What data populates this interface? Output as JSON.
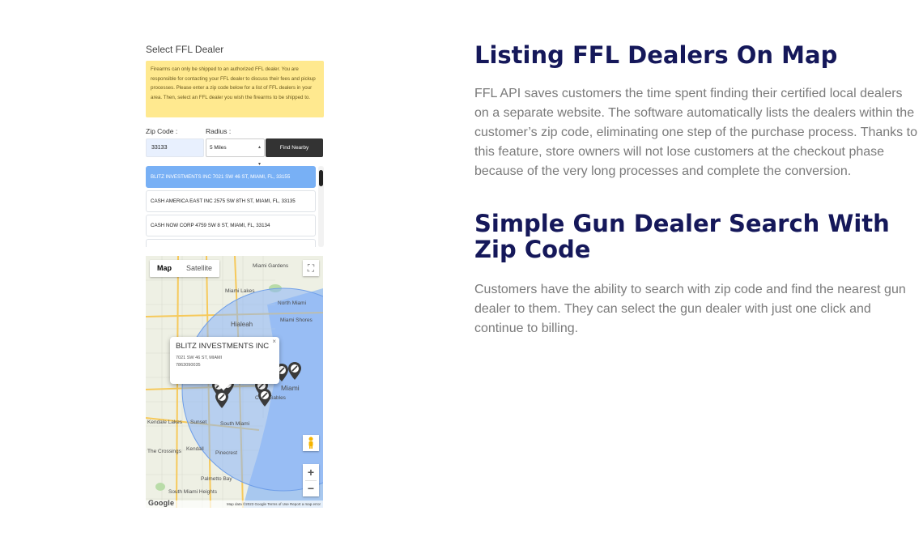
{
  "widget": {
    "title": "Select FFL Dealer",
    "notice": "Firearms can only be shipped to an authorized FFL dealer. You are responsible for contacting your FFL dealer to discuss their fees and pickup processes. Please enter a zip code below for a list of FFL dealers in your area. Then, select an FFL dealer you wish the firearms to be shipped to.",
    "zip_label": "Zip Code :",
    "radius_label": "Radius :",
    "zip_value": "33133",
    "radius_value": "5 Miles",
    "find_button": "Find Nearby",
    "dealers": [
      "BLITZ INVESTMENTS INC 7021 SW 46 ST, MIAMI, FL, 33155",
      "CASH AMERICA EAST INC 2575 SW 8TH ST, MIAMI, FL, 33135",
      "CASH NOW CORP 4759 SW 8 ST, MIAMI, FL, 33134"
    ]
  },
  "map": {
    "type_map": "Map",
    "type_satellite": "Satellite",
    "fullscreen_icon": "fullscreen-icon",
    "pegman_icon": "pegman-icon",
    "zoom_in": "+",
    "zoom_out": "−",
    "info": {
      "name": "BLITZ INVESTMENTS INC",
      "address": "7021 SW 46 ST, MIAMI",
      "phone": "7863090035",
      "close": "×"
    },
    "labels": {
      "miami_gardens": "Miami Gardens",
      "hialeah": "Hialeah",
      "north_miami": "North Miami",
      "miami_shores": "Miami Shores",
      "miami_lakes": "Miami Lakes",
      "miami": "Miami",
      "coral_gables": "Coral Gables",
      "kendale_lakes": "Kendale Lakes",
      "kendall": "Kendall",
      "the_crossings": "The Crossings",
      "south_miami": "South Miami",
      "south_miami_heights": "South Miami Heights",
      "sunset": "Sunset",
      "pinecrest": "Pinecrest",
      "palmetto_bay": "Palmetto Bay"
    },
    "google": "Google",
    "footer": "Map data ©2023 Google   Terms of Use   Report a map error",
    "colors": {
      "radius_fill": "#8ab4f8",
      "water": "#a8c8ef",
      "marker": "#3a3a3a"
    }
  },
  "content": {
    "heading1": "Listing FFL Dealers On Map",
    "para1": "FFL API saves customers the time spent finding their certified local dealers on a separate website. The software automatically lists the dealers within the customer’s zip code, eliminating one step of the purchase process. Thanks to this feature, store owners will not lose customers at the checkout phase because of the very long processes and complete the conversion.",
    "heading2": "Simple Gun Dealer Search With Zip Code",
    "para2": "Customers have the ability to search with zip code and find the nearest gun dealer to them. They can select the gun dealer with just one click and continue to billing.",
    "colors": {
      "heading": "#15185a",
      "body": "#7a7a7a"
    }
  }
}
